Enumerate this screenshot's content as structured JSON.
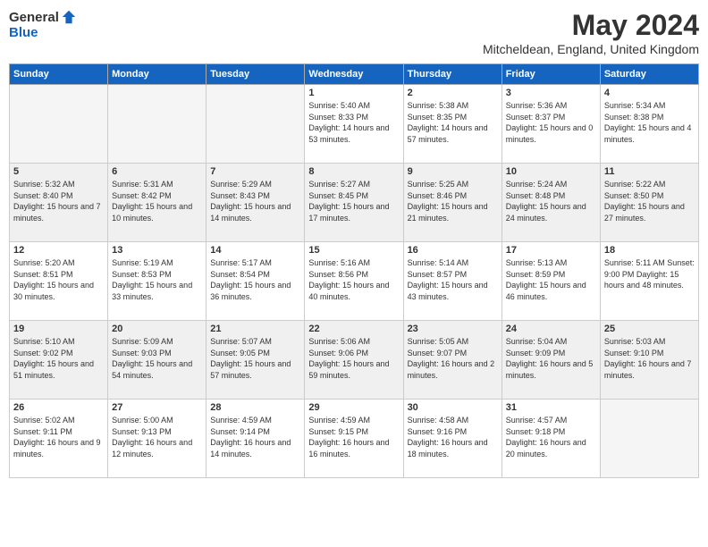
{
  "logo": {
    "general": "General",
    "blue": "Blue"
  },
  "title": "May 2024",
  "location": "Mitcheldean, England, United Kingdom",
  "days_header": [
    "Sunday",
    "Monday",
    "Tuesday",
    "Wednesday",
    "Thursday",
    "Friday",
    "Saturday"
  ],
  "weeks": [
    [
      {
        "day": "",
        "info": "",
        "empty": true
      },
      {
        "day": "",
        "info": "",
        "empty": true
      },
      {
        "day": "",
        "info": "",
        "empty": true
      },
      {
        "day": "1",
        "info": "Sunrise: 5:40 AM\nSunset: 8:33 PM\nDaylight: 14 hours and 53 minutes.",
        "empty": false
      },
      {
        "day": "2",
        "info": "Sunrise: 5:38 AM\nSunset: 8:35 PM\nDaylight: 14 hours and 57 minutes.",
        "empty": false
      },
      {
        "day": "3",
        "info": "Sunrise: 5:36 AM\nSunset: 8:37 PM\nDaylight: 15 hours and 0 minutes.",
        "empty": false
      },
      {
        "day": "4",
        "info": "Sunrise: 5:34 AM\nSunset: 8:38 PM\nDaylight: 15 hours and 4 minutes.",
        "empty": false
      }
    ],
    [
      {
        "day": "5",
        "info": "Sunrise: 5:32 AM\nSunset: 8:40 PM\nDaylight: 15 hours and 7 minutes.",
        "empty": false
      },
      {
        "day": "6",
        "info": "Sunrise: 5:31 AM\nSunset: 8:42 PM\nDaylight: 15 hours and 10 minutes.",
        "empty": false
      },
      {
        "day": "7",
        "info": "Sunrise: 5:29 AM\nSunset: 8:43 PM\nDaylight: 15 hours and 14 minutes.",
        "empty": false
      },
      {
        "day": "8",
        "info": "Sunrise: 5:27 AM\nSunset: 8:45 PM\nDaylight: 15 hours and 17 minutes.",
        "empty": false
      },
      {
        "day": "9",
        "info": "Sunrise: 5:25 AM\nSunset: 8:46 PM\nDaylight: 15 hours and 21 minutes.",
        "empty": false
      },
      {
        "day": "10",
        "info": "Sunrise: 5:24 AM\nSunset: 8:48 PM\nDaylight: 15 hours and 24 minutes.",
        "empty": false
      },
      {
        "day": "11",
        "info": "Sunrise: 5:22 AM\nSunset: 8:50 PM\nDaylight: 15 hours and 27 minutes.",
        "empty": false
      }
    ],
    [
      {
        "day": "12",
        "info": "Sunrise: 5:20 AM\nSunset: 8:51 PM\nDaylight: 15 hours and 30 minutes.",
        "empty": false
      },
      {
        "day": "13",
        "info": "Sunrise: 5:19 AM\nSunset: 8:53 PM\nDaylight: 15 hours and 33 minutes.",
        "empty": false
      },
      {
        "day": "14",
        "info": "Sunrise: 5:17 AM\nSunset: 8:54 PM\nDaylight: 15 hours and 36 minutes.",
        "empty": false
      },
      {
        "day": "15",
        "info": "Sunrise: 5:16 AM\nSunset: 8:56 PM\nDaylight: 15 hours and 40 minutes.",
        "empty": false
      },
      {
        "day": "16",
        "info": "Sunrise: 5:14 AM\nSunset: 8:57 PM\nDaylight: 15 hours and 43 minutes.",
        "empty": false
      },
      {
        "day": "17",
        "info": "Sunrise: 5:13 AM\nSunset: 8:59 PM\nDaylight: 15 hours and 46 minutes.",
        "empty": false
      },
      {
        "day": "18",
        "info": "Sunrise: 5:11 AM\nSunset: 9:00 PM\nDaylight: 15 hours and 48 minutes.",
        "empty": false
      }
    ],
    [
      {
        "day": "19",
        "info": "Sunrise: 5:10 AM\nSunset: 9:02 PM\nDaylight: 15 hours and 51 minutes.",
        "empty": false
      },
      {
        "day": "20",
        "info": "Sunrise: 5:09 AM\nSunset: 9:03 PM\nDaylight: 15 hours and 54 minutes.",
        "empty": false
      },
      {
        "day": "21",
        "info": "Sunrise: 5:07 AM\nSunset: 9:05 PM\nDaylight: 15 hours and 57 minutes.",
        "empty": false
      },
      {
        "day": "22",
        "info": "Sunrise: 5:06 AM\nSunset: 9:06 PM\nDaylight: 15 hours and 59 minutes.",
        "empty": false
      },
      {
        "day": "23",
        "info": "Sunrise: 5:05 AM\nSunset: 9:07 PM\nDaylight: 16 hours and 2 minutes.",
        "empty": false
      },
      {
        "day": "24",
        "info": "Sunrise: 5:04 AM\nSunset: 9:09 PM\nDaylight: 16 hours and 5 minutes.",
        "empty": false
      },
      {
        "day": "25",
        "info": "Sunrise: 5:03 AM\nSunset: 9:10 PM\nDaylight: 16 hours and 7 minutes.",
        "empty": false
      }
    ],
    [
      {
        "day": "26",
        "info": "Sunrise: 5:02 AM\nSunset: 9:11 PM\nDaylight: 16 hours and 9 minutes.",
        "empty": false
      },
      {
        "day": "27",
        "info": "Sunrise: 5:00 AM\nSunset: 9:13 PM\nDaylight: 16 hours and 12 minutes.",
        "empty": false
      },
      {
        "day": "28",
        "info": "Sunrise: 4:59 AM\nSunset: 9:14 PM\nDaylight: 16 hours and 14 minutes.",
        "empty": false
      },
      {
        "day": "29",
        "info": "Sunrise: 4:59 AM\nSunset: 9:15 PM\nDaylight: 16 hours and 16 minutes.",
        "empty": false
      },
      {
        "day": "30",
        "info": "Sunrise: 4:58 AM\nSunset: 9:16 PM\nDaylight: 16 hours and 18 minutes.",
        "empty": false
      },
      {
        "day": "31",
        "info": "Sunrise: 4:57 AM\nSunset: 9:18 PM\nDaylight: 16 hours and 20 minutes.",
        "empty": false
      },
      {
        "day": "",
        "info": "",
        "empty": true
      }
    ]
  ]
}
